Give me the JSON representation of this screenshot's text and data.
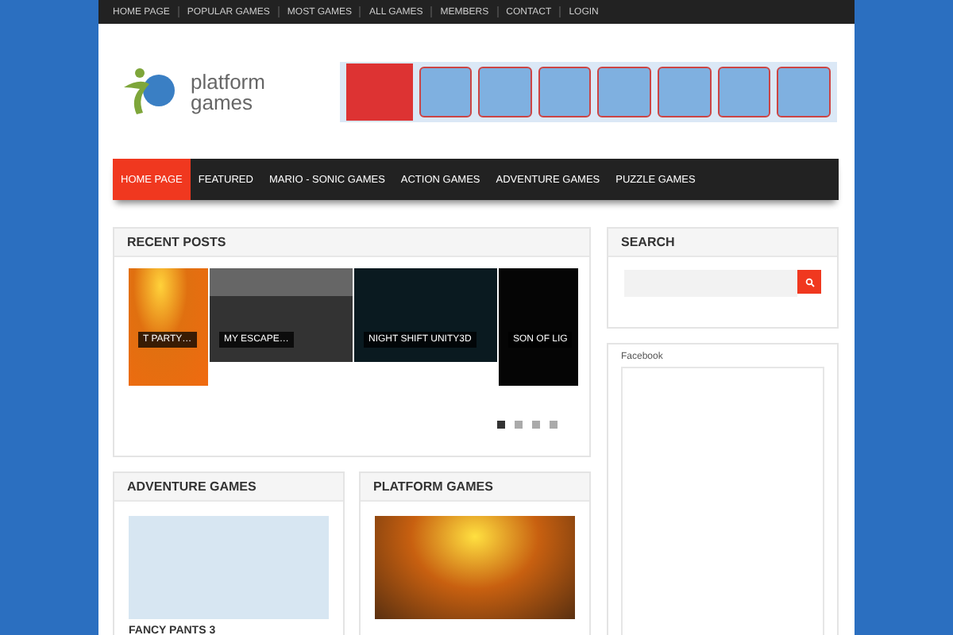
{
  "top_menu": [
    {
      "label": "HOME PAGE"
    },
    {
      "label": "POPULAR GAMES"
    },
    {
      "label": "MOST GAMES"
    },
    {
      "label": "ALL GAMES"
    },
    {
      "label": "MEMBERS"
    },
    {
      "label": "CONTACT"
    },
    {
      "label": "LOGIN"
    }
  ],
  "logo": {
    "line1": "platform",
    "line2": "games"
  },
  "main_nav": [
    {
      "label": "HOME PAGE",
      "selected": true
    },
    {
      "label": "FEATURED",
      "selected": false
    },
    {
      "label": "MARIO - SONIC GAMES",
      "selected": false
    },
    {
      "label": "ACTION GAMES",
      "selected": false
    },
    {
      "label": "ADVENTURE GAMES",
      "selected": false
    },
    {
      "label": "PUZZLE GAMES",
      "selected": false
    }
  ],
  "recent_posts": {
    "title": "RECENT POSTS",
    "slides": [
      {
        "caption": "T PARTY…"
      },
      {
        "caption": "MY ESCAPE…"
      },
      {
        "caption": "NIGHT SHIFT UNITY3D"
      },
      {
        "caption": "SON OF LIG"
      }
    ],
    "dots": [
      {
        "selected": true
      },
      {
        "selected": false
      },
      {
        "selected": false
      },
      {
        "selected": false
      }
    ]
  },
  "search": {
    "title": "SEARCH"
  },
  "facebook": {
    "label": "Facebook"
  },
  "sections": [
    {
      "title": "ADVENTURE GAMES",
      "post": {
        "caption": "FANCY PANTS 3"
      }
    },
    {
      "title": "PLATFORM GAMES"
    }
  ]
}
